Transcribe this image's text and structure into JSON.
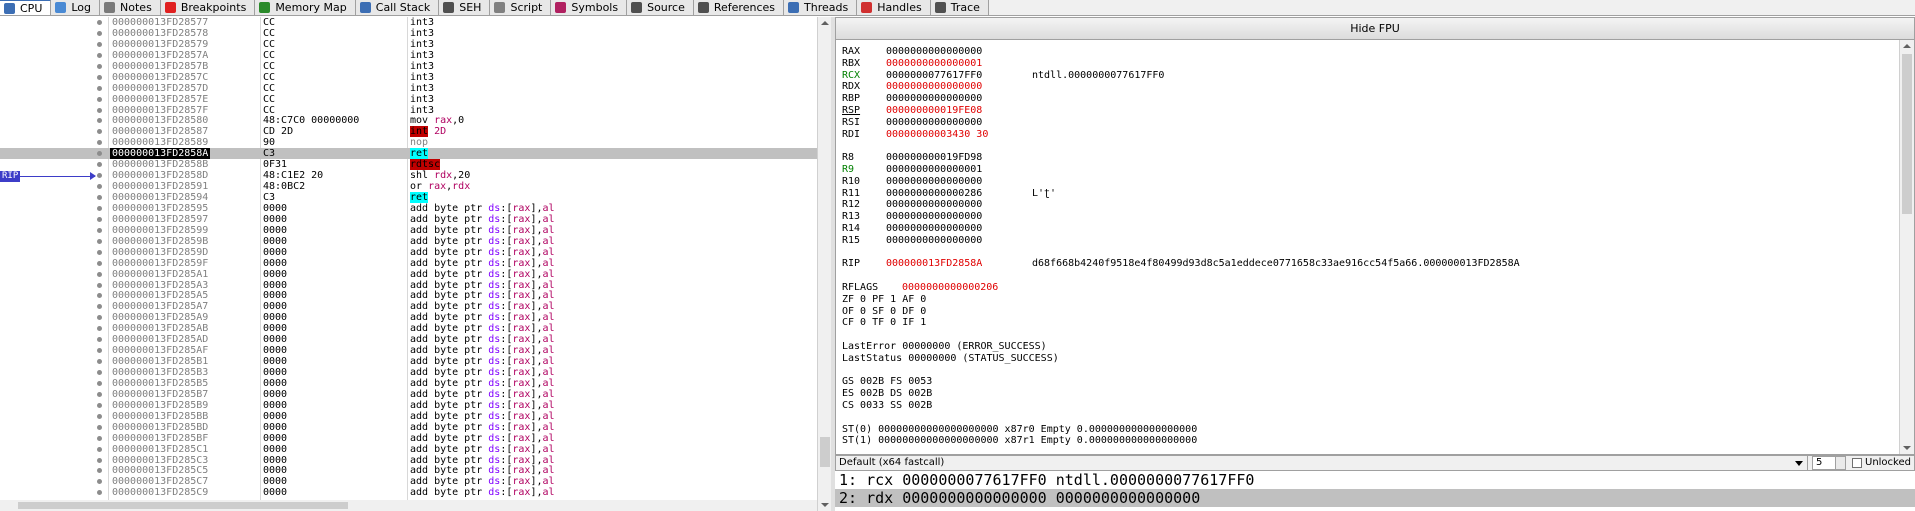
{
  "tabs": [
    {
      "label": "CPU",
      "icon": "cpu-icon",
      "color": "#3c6eb4"
    },
    {
      "label": "Log",
      "icon": "log-icon",
      "color": "#4a8ad4"
    },
    {
      "label": "Notes",
      "icon": "notes-icon",
      "color": "#7a7a7a"
    },
    {
      "label": "Breakpoints",
      "icon": "breakpoint-icon",
      "color": "#e02020"
    },
    {
      "label": "Memory Map",
      "icon": "memory-map-icon",
      "color": "#2a8a2a"
    },
    {
      "label": "Call Stack",
      "icon": "call-stack-icon",
      "color": "#3c6eb4"
    },
    {
      "label": "SEH",
      "icon": "seh-icon",
      "color": "#505050"
    },
    {
      "label": "Script",
      "icon": "script-icon",
      "color": "#808080"
    },
    {
      "label": "Symbols",
      "icon": "symbols-icon",
      "color": "#b02060"
    },
    {
      "label": "Source",
      "icon": "source-icon",
      "color": "#505050"
    },
    {
      "label": "References",
      "icon": "references-icon",
      "color": "#505050"
    },
    {
      "label": "Threads",
      "icon": "threads-icon",
      "color": "#3c6eb4"
    },
    {
      "label": "Handles",
      "icon": "handles-icon",
      "color": "#d03030"
    },
    {
      "label": "Trace",
      "icon": "trace-icon",
      "color": "#505050"
    }
  ],
  "disasm": {
    "rip_label": "RIP",
    "rows": [
      {
        "addr": "000000013FD28577",
        "bytes": "CC",
        "instr": "int3"
      },
      {
        "addr": "000000013FD28578",
        "bytes": "CC",
        "instr": "int3"
      },
      {
        "addr": "000000013FD28579",
        "bytes": "CC",
        "instr": "int3"
      },
      {
        "addr": "000000013FD2857A",
        "bytes": "CC",
        "instr": "int3"
      },
      {
        "addr": "000000013FD2857B",
        "bytes": "CC",
        "instr": "int3"
      },
      {
        "addr": "000000013FD2857C",
        "bytes": "CC",
        "instr": "int3"
      },
      {
        "addr": "000000013FD2857D",
        "bytes": "CC",
        "instr": "int3"
      },
      {
        "addr": "000000013FD2857E",
        "bytes": "CC",
        "instr": "int3"
      },
      {
        "addr": "000000013FD2857F",
        "bytes": "CC",
        "instr": "int3"
      },
      {
        "addr": "000000013FD28580",
        "bytes": "48:C7C0 00000000",
        "instr": "mov rax,0"
      },
      {
        "addr": "000000013FD28587",
        "bytes": "CD 2D",
        "instr": "int 2D"
      },
      {
        "addr": "000000013FD28589",
        "bytes": "90",
        "instr": "nop"
      },
      {
        "addr": "000000013FD2858A",
        "bytes": "C3",
        "instr": "ret"
      },
      {
        "addr": "000000013FD2858B",
        "bytes": "0F31",
        "instr": "rdtsc"
      },
      {
        "addr": "000000013FD2858D",
        "bytes": "48:C1E2 20",
        "instr": "shl rdx,20"
      },
      {
        "addr": "000000013FD28591",
        "bytes": "48:0BC2",
        "instr": "or rax,rdx"
      },
      {
        "addr": "000000013FD28594",
        "bytes": "C3",
        "instr": "ret"
      },
      {
        "addr": "000000013FD28595",
        "bytes": "0000",
        "instr": "add byte ptr ds:[rax],al"
      },
      {
        "addr": "000000013FD28597",
        "bytes": "0000",
        "instr": "add byte ptr ds:[rax],al"
      },
      {
        "addr": "000000013FD28599",
        "bytes": "0000",
        "instr": "add byte ptr ds:[rax],al"
      },
      {
        "addr": "000000013FD2859B",
        "bytes": "0000",
        "instr": "add byte ptr ds:[rax],al"
      },
      {
        "addr": "000000013FD2859D",
        "bytes": "0000",
        "instr": "add byte ptr ds:[rax],al"
      },
      {
        "addr": "000000013FD2859F",
        "bytes": "0000",
        "instr": "add byte ptr ds:[rax],al"
      },
      {
        "addr": "000000013FD285A1",
        "bytes": "0000",
        "instr": "add byte ptr ds:[rax],al"
      },
      {
        "addr": "000000013FD285A3",
        "bytes": "0000",
        "instr": "add byte ptr ds:[rax],al"
      },
      {
        "addr": "000000013FD285A5",
        "bytes": "0000",
        "instr": "add byte ptr ds:[rax],al"
      },
      {
        "addr": "000000013FD285A7",
        "bytes": "0000",
        "instr": "add byte ptr ds:[rax],al"
      },
      {
        "addr": "000000013FD285A9",
        "bytes": "0000",
        "instr": "add byte ptr ds:[rax],al"
      },
      {
        "addr": "000000013FD285AB",
        "bytes": "0000",
        "instr": "add byte ptr ds:[rax],al"
      },
      {
        "addr": "000000013FD285AD",
        "bytes": "0000",
        "instr": "add byte ptr ds:[rax],al"
      },
      {
        "addr": "000000013FD285AF",
        "bytes": "0000",
        "instr": "add byte ptr ds:[rax],al"
      },
      {
        "addr": "000000013FD285B1",
        "bytes": "0000",
        "instr": "add byte ptr ds:[rax],al"
      },
      {
        "addr": "000000013FD285B3",
        "bytes": "0000",
        "instr": "add byte ptr ds:[rax],al"
      },
      {
        "addr": "000000013FD285B5",
        "bytes": "0000",
        "instr": "add byte ptr ds:[rax],al"
      },
      {
        "addr": "000000013FD285B7",
        "bytes": "0000",
        "instr": "add byte ptr ds:[rax],al"
      },
      {
        "addr": "000000013FD285B9",
        "bytes": "0000",
        "instr": "add byte ptr ds:[rax],al"
      },
      {
        "addr": "000000013FD285BB",
        "bytes": "0000",
        "instr": "add byte ptr ds:[rax],al"
      },
      {
        "addr": "000000013FD285BD",
        "bytes": "0000",
        "instr": "add byte ptr ds:[rax],al"
      },
      {
        "addr": "000000013FD285BF",
        "bytes": "0000",
        "instr": "add byte ptr ds:[rax],al"
      },
      {
        "addr": "000000013FD285C1",
        "bytes": "0000",
        "instr": "add byte ptr ds:[rax],al"
      },
      {
        "addr": "000000013FD285C3",
        "bytes": "0000",
        "instr": "add byte ptr ds:[rax],al"
      },
      {
        "addr": "000000013FD285C5",
        "bytes": "0000",
        "instr": "add byte ptr ds:[rax],al"
      },
      {
        "addr": "000000013FD285C7",
        "bytes": "0000",
        "instr": "add byte ptr ds:[rax],al"
      },
      {
        "addr": "000000013FD285C9",
        "bytes": "0000",
        "instr": "add byte ptr ds:[rax],al"
      }
    ]
  },
  "registers": {
    "hide_fpu_label": "Hide FPU",
    "gp": [
      {
        "name": "RAX",
        "value": "0000000000000000",
        "changed": false,
        "comment": ""
      },
      {
        "name": "RBX",
        "value": "0000000000000001",
        "changed": true,
        "comment": ""
      },
      {
        "name": "RCX",
        "value": "0000000077617FF0",
        "changed": false,
        "comment": "ntdll.0000000077617FF0"
      },
      {
        "name": "RDX",
        "value": "0000000000000000",
        "changed": true,
        "comment": ""
      },
      {
        "name": "RBP",
        "value": "0000000000000000",
        "changed": false,
        "comment": ""
      },
      {
        "name": "RSP",
        "value": "000000000019FE08",
        "changed": true,
        "comment": ""
      },
      {
        "name": "RSI",
        "value": "0000000000000000",
        "changed": false,
        "comment": ""
      },
      {
        "name": "RDI",
        "value": "00000000003430 30",
        "changed": true,
        "comment": ""
      }
    ],
    "ext": [
      {
        "name": "R8",
        "value": "000000000019FD98",
        "changed": false,
        "comment": ""
      },
      {
        "name": "R9",
        "value": "0000000000000001",
        "changed": false,
        "comment": ""
      },
      {
        "name": "R10",
        "value": "0000000000000000",
        "changed": false,
        "comment": ""
      },
      {
        "name": "R11",
        "value": "0000000000000286",
        "changed": false,
        "comment": "L'ʈ'"
      },
      {
        "name": "R12",
        "value": "0000000000000000",
        "changed": false,
        "comment": ""
      },
      {
        "name": "R13",
        "value": "0000000000000000",
        "changed": false,
        "comment": ""
      },
      {
        "name": "R14",
        "value": "0000000000000000",
        "changed": false,
        "comment": ""
      },
      {
        "name": "R15",
        "value": "0000000000000000",
        "changed": false,
        "comment": ""
      }
    ],
    "rip": {
      "name": "RIP",
      "value": "000000013FD2858A",
      "comment": "d68f668b4240f9518e4f80499d93d8c5a1eddece0771658c33ae916cc54f5a66.000000013FD2858A"
    },
    "rflags": {
      "name": "RFLAGS",
      "value": "0000000000000206"
    },
    "flags_lines": [
      "ZF 0  PF 1  AF 0",
      "OF 0  SF 0  DF 0",
      "CF 0  TF 0  IF 1"
    ],
    "last_error": "LastError  00000000 (ERROR_SUCCESS)",
    "last_status": "LastStatus 00000000 (STATUS_SUCCESS)",
    "seg_lines": [
      "GS 002B  FS 0053",
      "ES 002B  DS 002B",
      "CS 0033  SS 002B"
    ],
    "fpu_lines": [
      "ST(0) 00000000000000000000 x87r0 Empty 0.000000000000000000",
      "ST(1) 00000000000000000000 x87r1 Empty 0.000000000000000000"
    ]
  },
  "callconv": {
    "selected": "Default (x64 fastcall)",
    "count": "5",
    "unlocked_label": "Unlocked"
  },
  "args": [
    "1: rcx 0000000077617FF0 ntdll.0000000077617FF0",
    "2: rdx 0000000000000000 0000000000000000"
  ]
}
